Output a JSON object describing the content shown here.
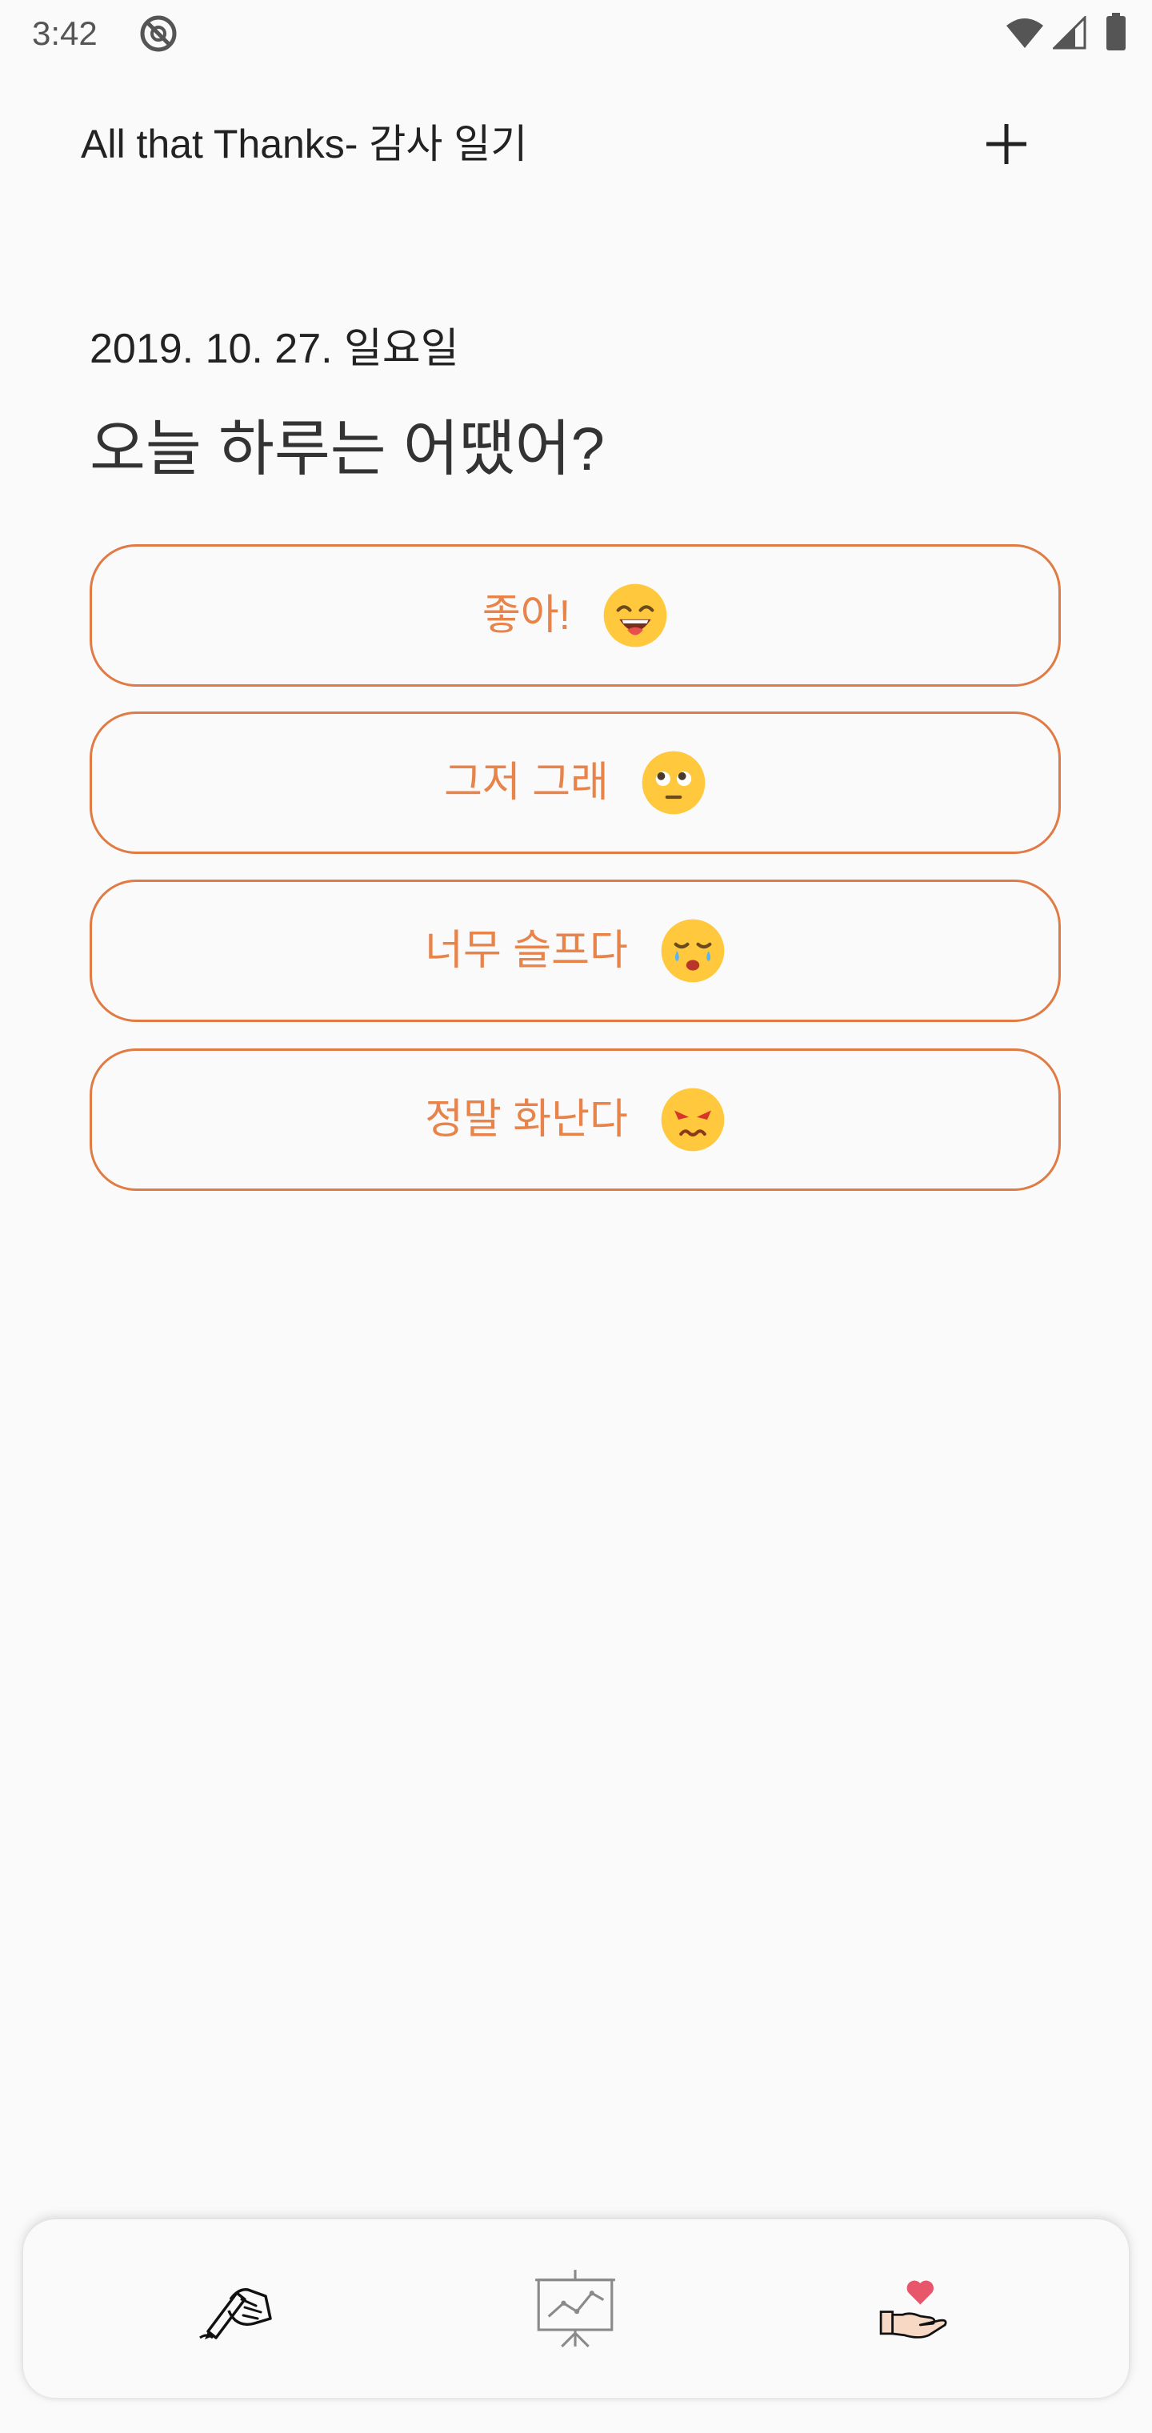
{
  "status_bar": {
    "time": "3:42",
    "icons": [
      "data-saver-icon",
      "wifi-icon",
      "signal-icon",
      "battery-icon"
    ]
  },
  "app_bar": {
    "title": "All that Thanks- 감사 일기",
    "action_icon": "plus-icon"
  },
  "main": {
    "date": "2019. 10. 27. 일요일",
    "question": "오늘 하루는 어땠어?",
    "moods": [
      {
        "label": "좋아!",
        "icon": "grinning-squinting-tongue-face-icon"
      },
      {
        "label": "그저 그래",
        "icon": "eye-roll-face-icon"
      },
      {
        "label": "너무 슬프다",
        "icon": "crying-face-icon"
      },
      {
        "label": "정말 화난다",
        "icon": "angry-face-icon"
      }
    ]
  },
  "bottom_nav": {
    "items": [
      {
        "icon": "writing-hand-icon",
        "active": true
      },
      {
        "icon": "presentation-chart-icon",
        "active": false
      },
      {
        "icon": "hand-heart-icon",
        "active": false
      }
    ]
  },
  "colors": {
    "background": "#FAFAFA",
    "accent": "#E8834A",
    "accent_border": "#E07B45",
    "emoji_face": "#FFC83D",
    "heart": "#E8566C"
  }
}
